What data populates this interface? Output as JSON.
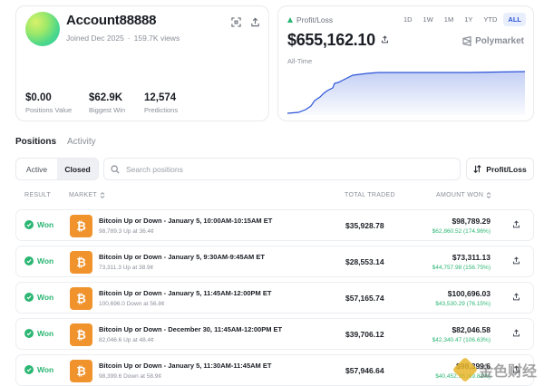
{
  "profile": {
    "username": "Account88888",
    "joined": "Joined Dec 2025",
    "views": "159.7K views",
    "stats": [
      {
        "value": "$0.00",
        "label": "Positions Value"
      },
      {
        "value": "$62.9K",
        "label": "Biggest Win"
      },
      {
        "value": "12,574",
        "label": "Predictions"
      }
    ]
  },
  "pnl": {
    "label": "Profit/Loss",
    "amount": "$655,162.10",
    "period": "All-Time",
    "brand": "Polymarket",
    "ranges": [
      "1D",
      "1W",
      "1M",
      "1Y",
      "YTD",
      "ALL"
    ],
    "active_range": "ALL",
    "line_color": "#2b54d8"
  },
  "tabs": {
    "positions": "Positions",
    "activity": "Activity"
  },
  "filter": {
    "active": "Active",
    "closed": "Closed"
  },
  "search": {
    "placeholder": "Search positions"
  },
  "sort": {
    "label": "Profit/Loss"
  },
  "table": {
    "headers": {
      "result": "RESULT",
      "market": "MARKET",
      "total_traded": "TOTAL TRADED",
      "amount_won": "AMOUNT WON"
    },
    "rows": [
      {
        "result": "Won",
        "title": "Bitcoin Up or Down - January 5, 10:00AM-10:15AM ET",
        "sub": "98,789.3 Up at 36.4¢",
        "traded": "$35,928.78",
        "won": "$98,789.29",
        "gain": "$62,860.52 (174.96%)"
      },
      {
        "result": "Won",
        "title": "Bitcoin Up or Down - January 5, 9:30AM-9:45AM ET",
        "sub": "73,311.3 Up at 38.9¢",
        "traded": "$28,553.14",
        "won": "$73,311.13",
        "gain": "$44,757.98 (156.75%)"
      },
      {
        "result": "Won",
        "title": "Bitcoin Up or Down - January 5, 11:45AM-12:00PM ET",
        "sub": "100,696.0 Down at 56.8¢",
        "traded": "$57,165.74",
        "won": "$100,696.03",
        "gain": "$43,530.29 (76.15%)"
      },
      {
        "result": "Won",
        "title": "Bitcoin Up or Down - December 30, 11:45AM-12:00PM ET",
        "sub": "82,046.6 Up at 48.4¢",
        "traded": "$39,706.12",
        "won": "$82,046.58",
        "gain": "$42,340.47 (106.63%)"
      },
      {
        "result": "Won",
        "title": "Bitcoin Up or Down - January 5, 11:30AM-11:45AM ET",
        "sub": "98,399.6 Down at 58.9¢",
        "traded": "$57,946.64",
        "won": "$98,399.6",
        "gain": "$40,452.96 (69.81%)"
      }
    ]
  },
  "watermark": "金色财经",
  "colors": {
    "accent": "#2b54d8",
    "success": "#2bb673",
    "bitcoin": "#f0932d"
  }
}
